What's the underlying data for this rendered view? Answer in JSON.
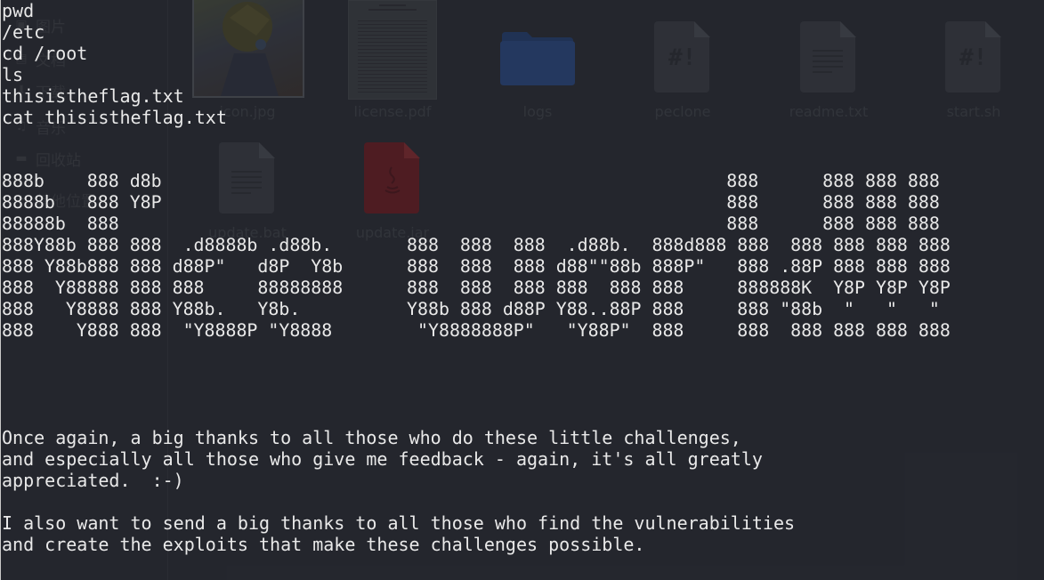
{
  "file_manager": {
    "sidebar": {
      "items": [
        {
          "label": "图片",
          "icon": "image-icon"
        },
        {
          "label": "文档",
          "icon": "document-icon"
        },
        {
          "label": "下载",
          "icon": "download-icon"
        },
        {
          "label": "音乐",
          "icon": "music-icon"
        },
        {
          "label": "回收站",
          "icon": "trash-icon"
        },
        {
          "label": "其他位置",
          "icon": "plus-icon"
        }
      ]
    },
    "files": [
      {
        "name": "icon.jpg",
        "kind": "image",
        "icon": "image-thumbnail-icon"
      },
      {
        "name": "license.pdf",
        "kind": "pdf",
        "icon": "pdf-thumbnail-icon"
      },
      {
        "name": "logs",
        "kind": "folder",
        "icon": "folder-icon"
      },
      {
        "name": "peclone",
        "kind": "script",
        "icon": "script-file-icon"
      },
      {
        "name": "readme.txt",
        "kind": "text",
        "icon": "text-file-icon"
      },
      {
        "name": "start.sh",
        "kind": "script",
        "icon": "script-file-icon"
      },
      {
        "name": "update.bat",
        "kind": "text",
        "icon": "text-file-icon"
      },
      {
        "name": "update.jar",
        "kind": "java",
        "icon": "java-file-icon"
      }
    ],
    "colors": {
      "folder": "#2a4a85",
      "java": "#6e1c22",
      "file": "#3a3c44"
    }
  },
  "terminal": {
    "commands": [
      "pwd",
      "/etc",
      "cd /root",
      "ls",
      "thisistheflag.txt",
      "cat thisistheflag.txt"
    ],
    "banner": [
      "888b    888 d8b                                                     888      888 888 888",
      "8888b   888 Y8P                                                     888      888 888 888",
      "88888b  888                                                         888      888 888 888",
      "888Y88b 888 888  .d8888b .d88b.       888  888  888  .d88b.  888d888 888  888 888 888 888",
      "888 Y88b888 888 d88P\"   d8P  Y8b      888  888  888 d88\"\"88b 888P\"   888 .88P 888 888 888",
      "888  Y88888 888 888     88888888      888  888  888 888  888 888     888888K  Y8P Y8P Y8P",
      "888   Y8888 888 Y88b.   Y8b.          Y88b 888 d88P Y88..88P 888     888 \"88b  \"   \"   \"",
      "888    Y888 888  \"Y8888P \"Y8888        \"Y8888888P\"   \"Y88P\"  888     888  888 888 888 888"
    ],
    "message": [
      "Once again, a big thanks to all those who do these little challenges,",
      "and especially all those who give me feedback - again, it's all greatly",
      "appreciated.  :-)",
      "",
      "I also want to send a big thanks to all those who find the vulnerabilities",
      "and create the exploits that make these challenges possible."
    ],
    "colors": {
      "text": "#e9e9e9",
      "background": "#23252d"
    }
  }
}
